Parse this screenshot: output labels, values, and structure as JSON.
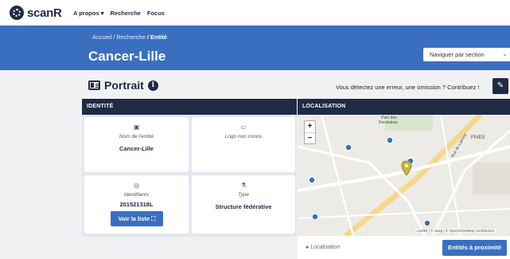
{
  "brand": {
    "name": "scanR"
  },
  "nav": {
    "items": [
      "A propos ▾",
      "Recherche",
      "Focus"
    ]
  },
  "breadcrumb": {
    "home": "Accueil",
    "sep1": "/",
    "search": "Recherche",
    "sep2": "/",
    "current": "Entité"
  },
  "entity": {
    "title": "Cancer-Lille"
  },
  "section_nav": {
    "selected": "Naviguer par section"
  },
  "portrait": {
    "title": "Portrait"
  },
  "feedback": {
    "text": "Vous détectez une erreur, une omission ? Contribuez !"
  },
  "identite": {
    "header": "IDENTITÉ",
    "name_card": {
      "label": "Nom de l'entité",
      "value": "Cancer-Lille"
    },
    "logo_card": {
      "label": "Logo non connu"
    },
    "ids_card": {
      "label": "Identifiants",
      "value": "201521318L",
      "button": "Voir la liste"
    },
    "type_card": {
      "label": "Type",
      "value": "Structure fédérative"
    }
  },
  "localisation": {
    "header": "LOCALISATION",
    "zoom_in": "+",
    "zoom_out": "−",
    "places": {
      "p1": "Parc des",
      "p2": "Dondaines",
      "p3": "FIVES",
      "p4": "Rue de Lannoy"
    },
    "attribution": "Leaflet | © Jawg | © OpenStreetMap contributors",
    "footer_label": "Localisation",
    "nearby_button": "Entités à proximité"
  },
  "colors": {
    "brand_navy": "#1f2a44",
    "accent_blue": "#3a6fc0",
    "map_pin": "#c9b43a"
  }
}
